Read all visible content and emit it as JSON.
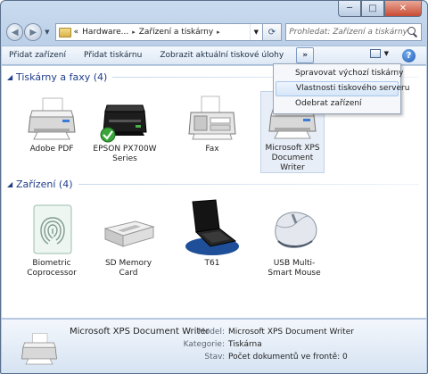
{
  "caption": {
    "minimize": "─",
    "maximize": "□",
    "close": "✕"
  },
  "address": {
    "overflow": "«",
    "crumbs": [
      "Hardware...",
      "Zařízení a tiskárny"
    ],
    "separator": "▸"
  },
  "search": {
    "placeholder": "Prohledat: Zařízení a tiskárny"
  },
  "toolbar": {
    "add_device": "Přidat zařízení",
    "add_printer": "Přidat tiskárnu",
    "show_queue": "Zobrazit aktuální tiskové úlohy",
    "more": "»",
    "help": "?"
  },
  "menu": {
    "items": [
      "Spravovat výchozí tiskárny",
      "Vlastnosti tiskového serveru",
      "Odebrat zařízení"
    ]
  },
  "groups": {
    "printers": {
      "title": "Tiskárny a faxy (4)",
      "items": [
        "Adobe PDF",
        "EPSON PX700W Series",
        "Fax",
        "Microsoft XPS Document Writer"
      ]
    },
    "devices": {
      "title": "Zařízení (4)",
      "items": [
        "Biometric Coprocessor",
        "SD Memory Card",
        "T61",
        "USB Multi-Smart Mouse"
      ]
    }
  },
  "details": {
    "name": "Microsoft XPS Document Writer",
    "model_label": "Model:",
    "model_value": "Microsoft XPS Document Writer",
    "category_label": "Kategorie:",
    "category_value": "Tiskárna",
    "status_label": "Stav:",
    "status_value": "Počet dokumentů ve frontě: 0"
  }
}
